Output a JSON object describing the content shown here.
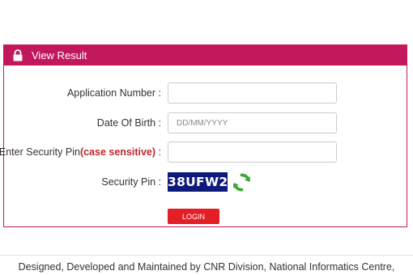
{
  "panel": {
    "title": "View Result",
    "lock_icon": "lock-icon",
    "header_color": "#c2185b"
  },
  "form": {
    "application_number": {
      "label": "Application Number :",
      "value": "",
      "placeholder": ""
    },
    "date_of_birth": {
      "label": "Date Of Birth :",
      "value": "",
      "placeholder": "DD/MM/YYYY"
    },
    "security_pin_input": {
      "label_prefix": "Enter Security Pin",
      "label_emphasis": "(case sensitive)",
      "label_suffix": " :",
      "value": "",
      "placeholder": ""
    },
    "security_pin_display": {
      "label": "Security Pin :",
      "code": "38UFW2",
      "refresh_icon": "refresh-icon"
    },
    "login_label": "LOGIN",
    "login_color": "#e31e24"
  },
  "footer": {
    "text": "Designed, Developed and Maintained by CNR Division, National Informatics Centre,"
  }
}
